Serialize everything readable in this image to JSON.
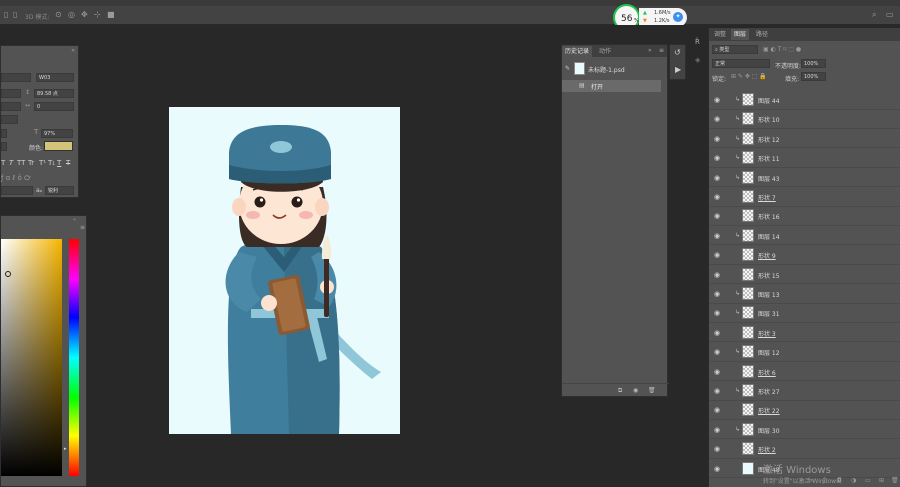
{
  "toolbar": {
    "mode_label": "3D 模式:"
  },
  "speed_widget": {
    "percent": "56",
    "percent_sign": "%",
    "up": "1.6M/s",
    "down": "1.2K/s"
  },
  "char_props": {
    "font_style": "W03",
    "size": "89.58 点",
    "tracking_value": "0",
    "scale": "97%",
    "color_label": "颜色:",
    "aa": "锐利",
    "typo_buttons": [
      "T",
      "T",
      "TT",
      "Tr",
      "T¹",
      "T₁",
      "T",
      "T"
    ]
  },
  "history": {
    "tabs": [
      "历史记录",
      "动作"
    ],
    "snapshot": "未标题-1.psd",
    "items": [
      "打开"
    ]
  },
  "layers_panel": {
    "tabs": [
      "调整",
      "图层",
      "路径"
    ],
    "filter_kind": "类型",
    "blend_mode": "正常",
    "opacity_label": "不透明度:",
    "opacity_value": "100%",
    "lock_label": "锁定:",
    "fill_label": "填充:",
    "fill_value": "100%",
    "layers": [
      {
        "name": "图层 44"
      },
      {
        "name": "形状 10"
      },
      {
        "name": "形状 12"
      },
      {
        "name": "形状 11"
      },
      {
        "name": "图层 43"
      },
      {
        "name": "形状 7"
      },
      {
        "name": "形状 16"
      },
      {
        "name": "图层 14"
      },
      {
        "name": "形状 9"
      },
      {
        "name": "形状 15"
      },
      {
        "name": "图层 13"
      },
      {
        "name": "图层 31"
      },
      {
        "name": "形状 3"
      },
      {
        "name": "图层 12"
      },
      {
        "name": "形状 6"
      },
      {
        "name": "形状 27"
      },
      {
        "name": "形状 22"
      },
      {
        "name": "图层 30"
      },
      {
        "name": "形状 2"
      },
      {
        "name": "图层 48"
      }
    ]
  },
  "watermark": {
    "line1": "激活 Windows",
    "line2": "转到\"设置\"以激活 Windows。"
  },
  "colors": {
    "panel_bg": "#535353",
    "canvas_bg": "#282828",
    "doc_bg": "#e9fbfd",
    "swatch": "#d4c47a",
    "accent_green": "#1ec44b"
  }
}
